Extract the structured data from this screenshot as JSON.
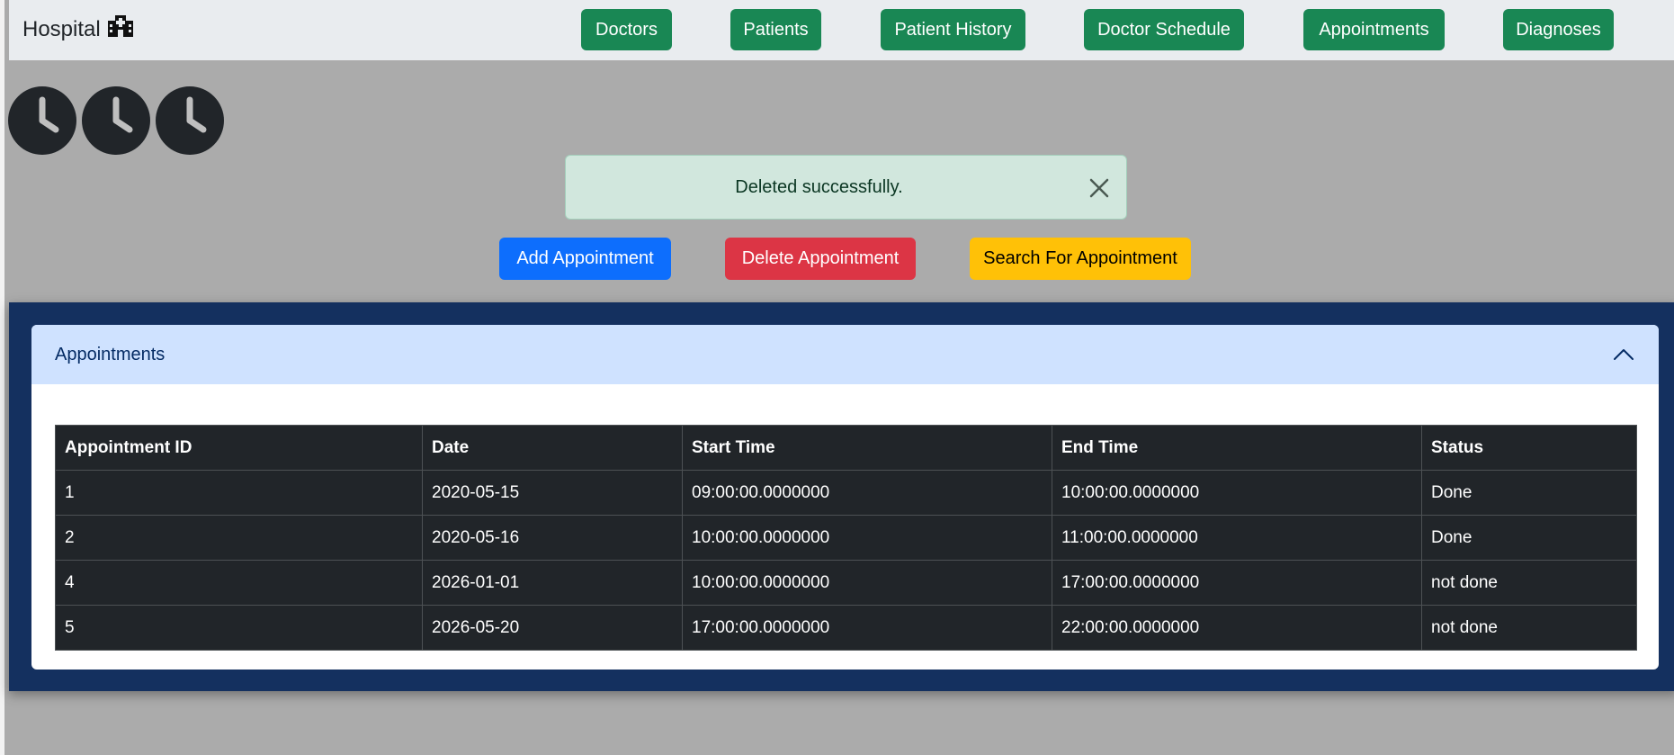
{
  "nav": {
    "brand": "Hospital",
    "brand_icon": "hospital-icon",
    "items": [
      {
        "label": "Doctors"
      },
      {
        "label": "Patients"
      },
      {
        "label": "Patient History"
      },
      {
        "label": "Doctor Schedule"
      },
      {
        "label": "Appointments"
      },
      {
        "label": "Diagnoses"
      }
    ],
    "button_color": "#198754"
  },
  "clocks": [
    "clock-icon",
    "clock-icon",
    "clock-icon"
  ],
  "alert": {
    "message": "Deleted successfully.",
    "type": "success",
    "close_icon": "close-icon"
  },
  "actions": {
    "add_label": "Add Appointment",
    "delete_label": "Delete Appointment",
    "search_label": "Search For Appointment"
  },
  "appointments_card": {
    "title": "Appointments",
    "toggle_icon": "chevron-up-icon",
    "columns": [
      "Appointment ID",
      "Date",
      "Start Time",
      "End Time",
      "Status"
    ],
    "rows": [
      [
        "1",
        "2020-05-15",
        "09:00:00.0000000",
        "10:00:00.0000000",
        "Done"
      ],
      [
        "2",
        "2020-05-16",
        "10:00:00.0000000",
        "11:00:00.0000000",
        "Done"
      ],
      [
        "4",
        "2026-01-01",
        "10:00:00.0000000",
        "17:00:00.0000000",
        "not done"
      ],
      [
        "5",
        "2026-05-20",
        "17:00:00.0000000",
        "22:00:00.0000000",
        "not done"
      ]
    ]
  },
  "colors": {
    "page_background": "#ababab",
    "panel_background": "#14305f",
    "primary": "#0d6efd",
    "danger": "#dc3545",
    "warning": "#ffc107",
    "success_alert": "#d1e7dd"
  }
}
